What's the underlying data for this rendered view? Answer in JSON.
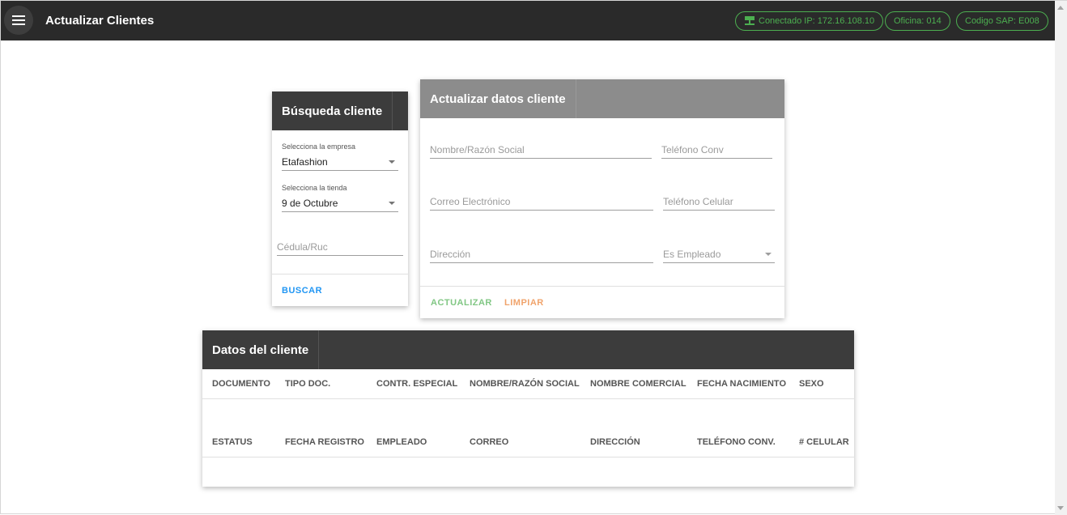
{
  "header": {
    "title": "Actualizar Clientes",
    "menu_icon": "menu-icon",
    "chips": {
      "connection": "Conectado IP: 172.16.108.10",
      "office": "Oficina: 014",
      "sap": "Codigo SAP: E008"
    },
    "accent": "#4caf50"
  },
  "search_card": {
    "title": "Búsqueda cliente",
    "empresa_label": "Selecciona la empresa",
    "empresa_value": "Etafashion",
    "tienda_label": "Selecciona la tienda",
    "tienda_value": "9 de Octubre",
    "cedula_placeholder": "Cédula/Ruc",
    "search_button": "BUSCAR"
  },
  "update_card": {
    "title": "Actualizar datos cliente",
    "nombre_placeholder": "Nombre/Razón Social",
    "telefono_conv_placeholder": "Teléfono Conv",
    "correo_placeholder": "Correo Electrónico",
    "telefono_cel_placeholder": "Teléfono Celular",
    "direccion_placeholder": "Dirección",
    "empleado_placeholder": "Es Empleado",
    "update_button": "ACTUALIZAR",
    "clear_button": "LIMPIAR"
  },
  "client_table": {
    "title": "Datos del cliente",
    "row1_headers": [
      "DOCUMENTO",
      "TIPO DOC.",
      "CONTR. ESPECIAL",
      "NOMBRE/RAZÓN SOCIAL",
      "NOMBRE COMERCIAL",
      "FECHA NACIMIENTO",
      "SEXO"
    ],
    "row2_headers": [
      "ESTATUS",
      "FECHA REGISTRO",
      "EMPLEADO",
      "CORREO",
      "DIRECCIÓN",
      "TELÉFONO CONV.",
      "# CELULAR"
    ]
  }
}
